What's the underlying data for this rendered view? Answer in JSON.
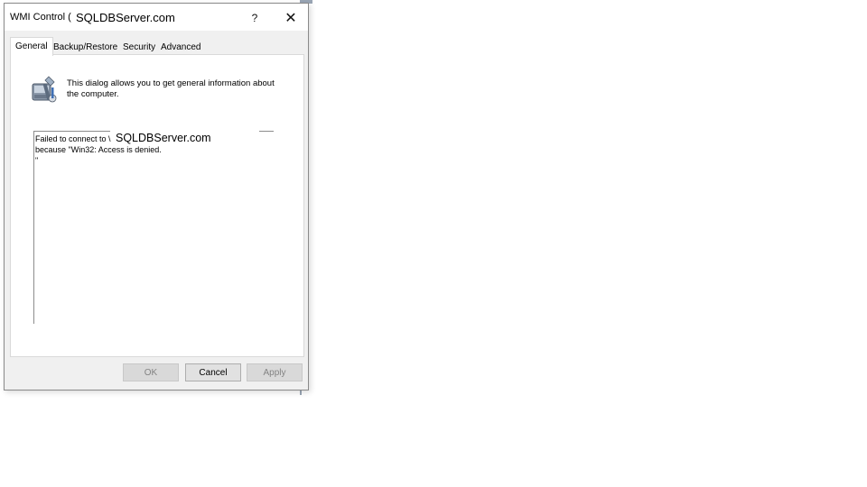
{
  "window": {
    "title": "WMI Control (",
    "title_overlay": "SQLDBServer.com",
    "help_glyph": "?",
    "close_glyph": "✕"
  },
  "tabs": [
    {
      "label": "General",
      "active": true
    },
    {
      "label": "Backup/Restore",
      "active": false
    },
    {
      "label": "Security",
      "active": false
    },
    {
      "label": "Advanced",
      "active": false
    }
  ],
  "general": {
    "description": "This dialog allows you to get general information about the computer.",
    "icon": "wmi-control-icon",
    "status_text": "Failed to connect to \\\nbecause \"Win32: Access is denied.\n\"",
    "status_overlay": "SQLDBServer.com"
  },
  "buttons": {
    "ok": {
      "label": "OK",
      "enabled": false
    },
    "cancel": {
      "label": "Cancel",
      "enabled": true
    },
    "apply": {
      "label": "Apply",
      "enabled": false
    }
  },
  "colors": {
    "dialog_bg": "#f0f0f0",
    "panel_bg": "#ffffff",
    "disabled_text": "#838383"
  }
}
